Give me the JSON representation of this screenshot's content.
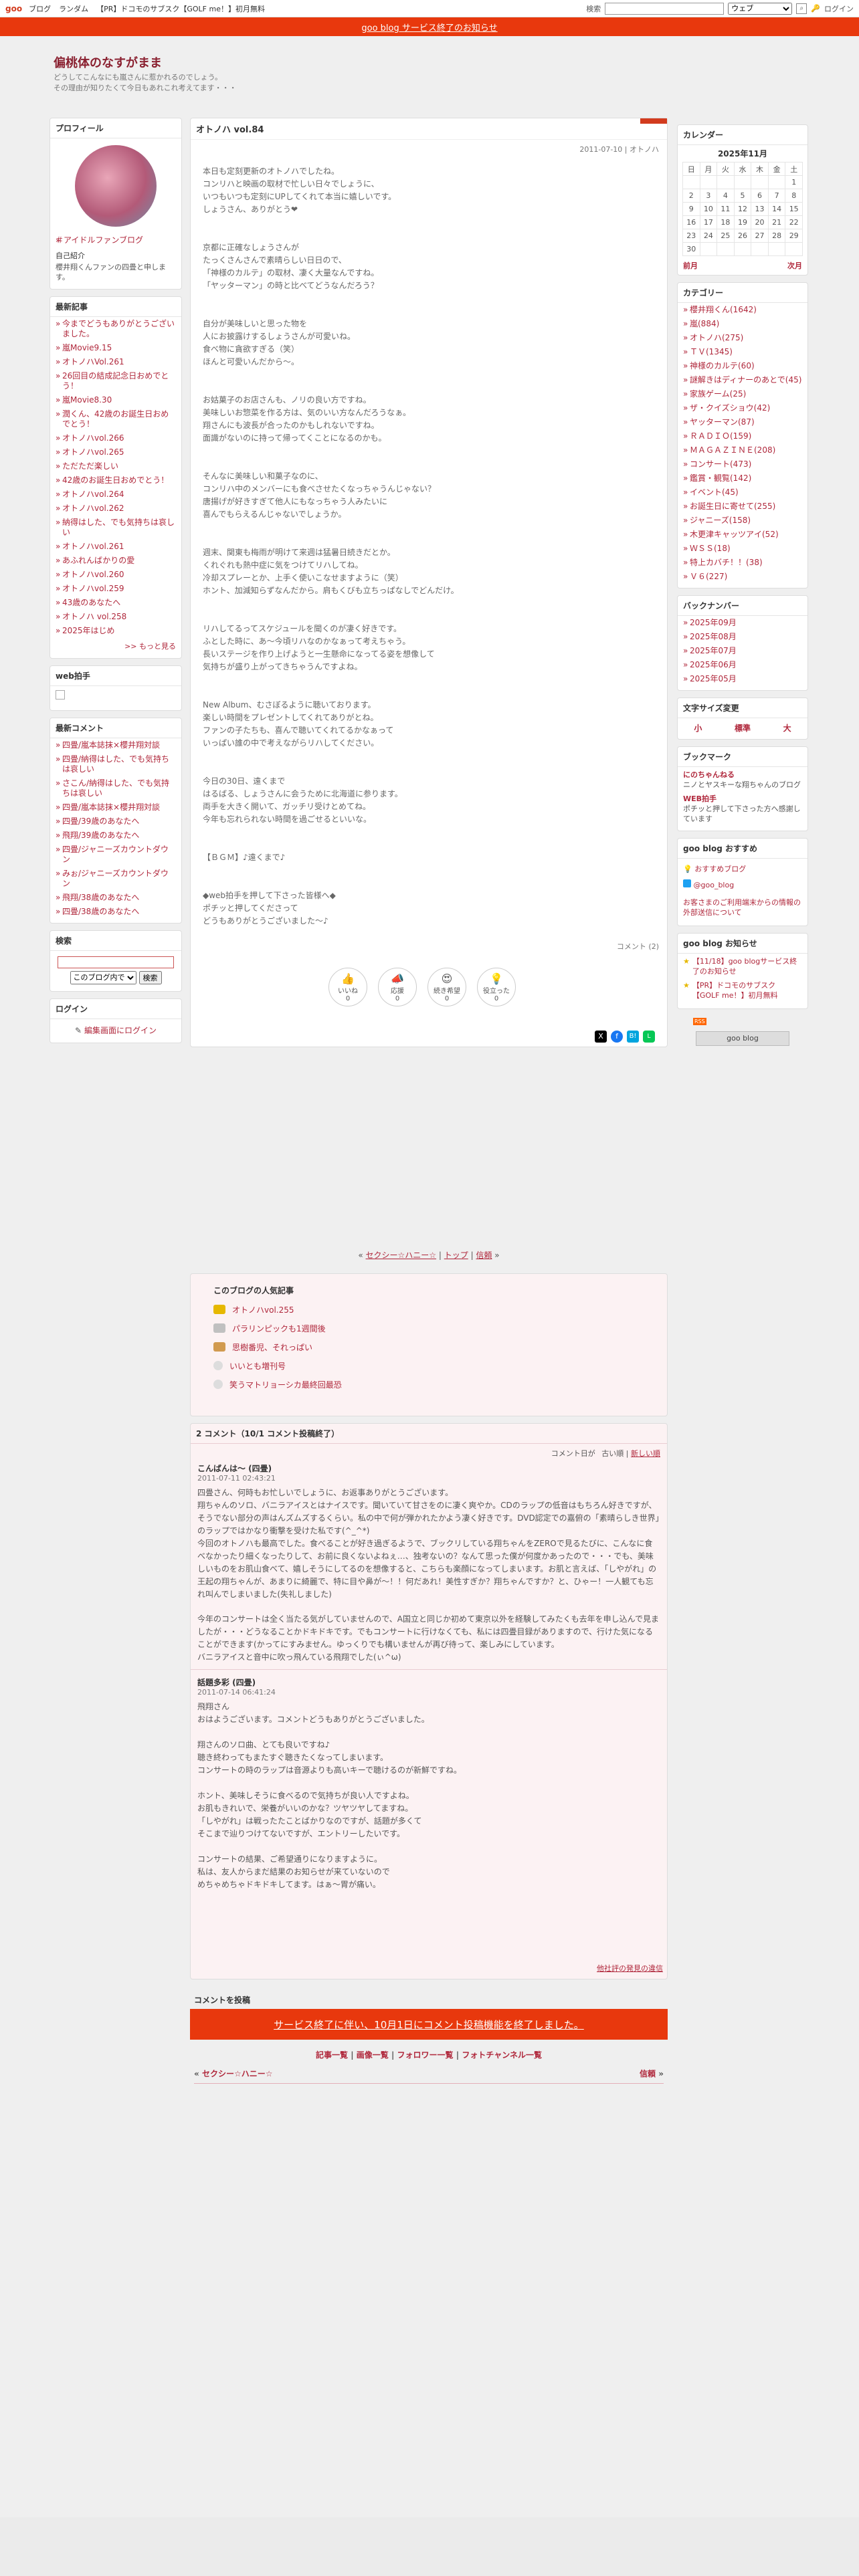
{
  "topbar": {
    "logo": "goo",
    "links": [
      "ブログ",
      "ランダム",
      "【PR】ドコモのサブスク【GOLF me！】初月無料"
    ],
    "search_label": "検索",
    "search_select": "ウェブ",
    "login": "ログイン"
  },
  "banner": "goo blog サービス終了のお知らせ",
  "blog": {
    "title": "偏桃体のなすがまま",
    "description": [
      "どうしてこんなにも嵐さんに惹かれるのでしょう。",
      "その理由が知りたくて今日もあれこれ考えてます・・・"
    ]
  },
  "profile": {
    "heading": "プロフィール",
    "name_link": "＃アイドルファンブログ",
    "intro_label": "自己紹介",
    "intro": "櫻井翔くんファンの四畳と申します。"
  },
  "recent": {
    "heading": "最新記事",
    "items": [
      "今までどうもありがとうございました。",
      "嵐Movie9.15",
      "オトノハVol.261",
      "26回目の結成記念日おめでとう！",
      "嵐Movie8.30",
      "潤くん、42歳のお誕生日おめでとう！",
      "オトノハvol.266",
      "オトノハvol.265",
      "ただただ楽しい",
      "42歳のお誕生日おめでとう！",
      "オトノハvol.264",
      "オトノハvol.262",
      "納得はした、でも気持ちは哀しい",
      "オトノハvol.261",
      "あふれんばかりの愛",
      "オトノハvol.260",
      "オトノハvol.259",
      "43歳のあなたへ",
      "オトノハ vol.258",
      "2025年はじめ"
    ],
    "more": ">> もっと見る"
  },
  "webclap": {
    "heading": "web拍手"
  },
  "comments_side": {
    "heading": "最新コメント",
    "items": [
      "四畳/嵐本誌抹×櫻井翔対談",
      "四畳/納得はした、でも気持ちは哀しい",
      "さこん/納得はした、でも気持ちは哀しい",
      "四畳/嵐本誌抹×櫻井翔対談",
      "四畳/39歳のあなたへ",
      "飛翔/39歳のあなたへ",
      "四畳/ジャニーズカウントダウン",
      "みぉ/ジャニーズカウントダウン",
      "飛翔/38歳のあなたへ",
      "四畳/38歳のあなたへ"
    ]
  },
  "search": {
    "heading": "検索",
    "select": "このブログ内で",
    "button": "検索"
  },
  "login_box": {
    "heading": "ログイン",
    "link": "編集画面にログイン"
  },
  "article": {
    "title": "オトノハ vol.84",
    "meta": "2011-07-10 | オトノハ",
    "paragraphs": [
      [
        "本日も定刻更新のオトノハでしたね。",
        "コンリハと映画の取材で忙しい日々でしょうに、",
        "いつもいつも定刻にUPしてくれて本当に嬉しいです。",
        "しょうさん、ありがとう❤"
      ],
      [
        "京都に正確なしょうさんが",
        "たっくさんさんで素晴らしい日日ので、",
        "「神様のカルテ」の取材、凄く大量なんですね。",
        "「ヤッターマン」の時と比べてどうなんだろう？"
      ],
      [
        "自分が美味しいと思った物を",
        "人にお披露けするしょうさんが可愛いね。",
        "食べ物に貪欲すぎる（笑）",
        "ほんと可愛いんだから～。"
      ],
      [
        "お姑菓子のお店さんも、ノリの良い方ですね。",
        "美味しいお惣菜を作る方は、気のいい方なんだろうなぁ。",
        "翔さんにも波長が合ったのかもしれないですね。",
        "面識がないのに持って帰ってくことになるのかも。"
      ],
      [
        "そんなに美味しい和菓子なのに、",
        "コンリハ中のメンバーにも食べさせたくなっちゃうんじゃない？",
        "唐揚げが好きすぎて他人にもなっちゃう人みたいに",
        "喜んでもらえるんじゃないでしょうか。"
      ],
      [
        "週末、関東も梅雨が明けて来週は猛暑日続きだとか。",
        "くれぐれも熱中症に気をつけてリハしてね。",
        "冷却スプレーとか、上手く使いこなせますように（笑）",
        "ホント、加減知らずなんだから。肩もくびも立ちっぱなしでどんだけ。"
      ],
      [
        "リハしてるってスケジュールを聞くのが凄く好きです。",
        "ふとした時に、あ～今頃リハなのかなぁって考えちゃう。",
        "長いステージを作り上げようと一生懸命になってる姿を想像して",
        "気持ちが盛り上がってきちゃうんですよね。"
      ],
      [
        "New Album、むさぼるように聴いております。",
        "楽しい時間をプレゼントしてくれてありがとね。",
        "ファンの子たちも、喜んで聴いてくれてるかなぁって",
        "いっぱい誰の中で考えながらリハしてください。"
      ],
      [
        "今日の30日、遠くまで",
        "はるばる、しょうさんに会うために北海道に参ります。",
        "両手を大きく開いて、ガッチリ受けとめてね。",
        "今年も忘れられない時間を過ごせるといいな。"
      ],
      [
        "【ＢＧＭ】♪遠くまで♪"
      ],
      [
        "◆web拍手を押して下さった皆様へ◆",
        "ポチッと押してくださって",
        "どうもありがとうございました～♪"
      ]
    ],
    "comment_count": "コメント (2)",
    "reactions": [
      {
        "label": "いいね",
        "count": "0"
      },
      {
        "label": "応援",
        "count": "0"
      },
      {
        "label": "続き希望",
        "count": "0"
      },
      {
        "label": "役立った",
        "count": "0"
      }
    ]
  },
  "nav": {
    "prev": "セクシー☆ハニー☆",
    "top": "トップ",
    "next": "信頼"
  },
  "popular": {
    "heading": "このブログの人気記事",
    "items": [
      "オトノハvol.255",
      "パラリンピックも1週間後",
      "思樹番児、それっぱい",
      "いいとも増刊号",
      "笑うマトリョーシカ最終回最恐"
    ]
  },
  "comments": {
    "heading": "2 コメント（10/1 コメント投稿終了）",
    "sort_label": "コメント日が",
    "old": "古い順",
    "new": "新しい順",
    "items": [
      {
        "name": "こんばんは～ (四畳)",
        "date": "2011-07-11 02:43:21",
        "lines": [
          "四畳さん、何時もお忙しいでしょうに、お返事ありがとうございます。",
          "翔ちゃんのソロ、バニラアイスとはナイスです。聞いていて甘さをのに凄く爽やか。CDのラップの低音はもちろん好きですが、そうでない部分の声はんズムズするくらい。私の中で何が弾かれたかよう凄く好きです。DVD認定での嘉俯の「素晴らしき世界」のラップではかなり衝撃を受けた私です(^_^*)",
          "今回のオトノハも最高でした。食べることが好き過ぎるようで、ブックリしている翔ちゃんをZEROで見るたびに、こんなに食べなかったり細くなったりして、お前に良くないよねぇ…、独考ないの？なんて思った僕が何度かあったので・・・でも、美味しいものをお肌山食べて、嬉しそうにしてるのを想像すると、こちらも楽顔になってしまいます。お肌と言えば、「しやがれ」の王起の翔ちゃんが、あまりに綺麗で、特に目や鼻が～！！何だあれ！美性すぎか？翔ちゃんですか？と、ひゃー！一人観ても忘れ叫んでしまいました(失礼しました)",
          "今年のコンサートは全く当たる気がしていませんので、A国立と同じか初めて東京以外を経験してみたくも去年を申し込んで見ましたが・・・どうなることかドキドキです。でもコンサートに行けなくても、私には四畳目録がありますので、行けた気になることができます(かってにすみません。ゆっくりでも構いませんが再び待って、楽しみにしています。",
          "バニラアイスと音中に吹っ飛んている飛翔でした(ぃ^ω)"
        ]
      },
      {
        "name": "話題多彩 (四畳)",
        "date": "2011-07-14 06:41:24",
        "lines": [
          "飛翔さん",
          "おはようございます。コメントどうもありがとうございました。",
          "",
          "翔さんのソロ曲、とても良いですね♪",
          "聴き終わってもまたすぐ聴きたくなってしまいます。",
          "コンサートの時のラップは音源よりも高いキーで聴けるのが新鮮ですね。",
          "",
          "ホント、美味しそうに食べるので気持ちが良い人ですよね。",
          "お肌もきれいで、栄養がいいのかな？ツヤツヤしてますね。",
          "「しやがれ」は戦ったたことばかりなのですが、話題が多くて",
          "そこまで辿りつけてないですが、エントリーしたいです。",
          "",
          "コンサートの結果、ご希望通りになりますように。",
          "私は、友人からまだ結果のお知らせが来ていないので",
          "めちゃめちゃドキドキしてます。はぁ～胃が痛い。"
        ]
      }
    ],
    "report": "他社評の発見の違信"
  },
  "post_comment": {
    "heading": "コメントを投稿",
    "notice": "サービス終了に伴い、10月1日にコメント投稿機能を終了しました。"
  },
  "footer_links": [
    "記事一覧",
    "画像一覧",
    "フォロワー一覧",
    "フォトチャンネル一覧"
  ],
  "footer_nav": {
    "prev": "セクシー☆ハニー☆",
    "next": "信頼"
  },
  "calendar": {
    "heading": "カレンダー",
    "month": "2025年11月",
    "days": [
      "日",
      "月",
      "火",
      "水",
      "木",
      "金",
      "土"
    ],
    "weeks": [
      [
        "",
        "",
        "",
        "",
        "",
        "",
        "1"
      ],
      [
        "2",
        "3",
        "4",
        "5",
        "6",
        "7",
        "8"
      ],
      [
        "9",
        "10",
        "11",
        "12",
        "13",
        "14",
        "15"
      ],
      [
        "16",
        "17",
        "18",
        "19",
        "20",
        "21",
        "22"
      ],
      [
        "23",
        "24",
        "25",
        "26",
        "27",
        "28",
        "29"
      ],
      [
        "30",
        "",
        "",
        "",
        "",
        "",
        ""
      ]
    ],
    "prev": "前月",
    "next": "次月"
  },
  "categories": {
    "heading": "カテゴリー",
    "items": [
      "櫻井翔くん(1642)",
      "嵐(884)",
      "オトノハ(275)",
      "ＴＶ(1345)",
      "神様のカルテ(60)",
      "謎解きはディナーのあとで(45)",
      "家族ゲーム(25)",
      "ザ・クイズショウ(42)",
      "ヤッターマン(87)",
      "ＲＡＤＩＯ(159)",
      "ＭＡＧＡＺＩＮＥ(208)",
      "コンサート(473)",
      "鑑賞・観覧(142)",
      "イベント(45)",
      "お誕生日に寄せて(255)",
      "ジャニーズ(158)",
      "木更津キャッツアイ(52)",
      "ＷＳＳ(18)",
      "特上カバチ！！(38)",
      "Ｖ６(227)"
    ]
  },
  "backnumber": {
    "heading": "バックナンバー",
    "items": [
      "2025年09月",
      "2025年08月",
      "2025年07月",
      "2025年06月",
      "2025年05月"
    ]
  },
  "fontsize": {
    "heading": "文字サイズ変更",
    "small": "小",
    "normal": "標準",
    "large": "大"
  },
  "bookmark": {
    "heading": "ブックマーク",
    "items": [
      {
        "title": "にのちゃんねる",
        "desc": "ニノとヤスキーな翔ちゃんのブログ"
      },
      {
        "title": "WEB拍手",
        "desc": "ポチッと押して下さった方へ感謝しています"
      }
    ]
  },
  "recommend": {
    "heading": "goo blog おすすめ",
    "items": [
      "おすすめブログ",
      "@goo_blog"
    ],
    "notice": "お客さまのご利用端末からの情報の外部送信について"
  },
  "news": {
    "heading": "goo blog お知らせ",
    "items": [
      "【11/18】goo blogサービス終了のお知らせ",
      "【PR】ドコモのサブスク【GOLF me！】初月無料"
    ]
  },
  "rss": "RSS",
  "gooblog": "goo blog",
  "colors": {
    "accent": "#e8380d",
    "link": "#b0283c"
  }
}
